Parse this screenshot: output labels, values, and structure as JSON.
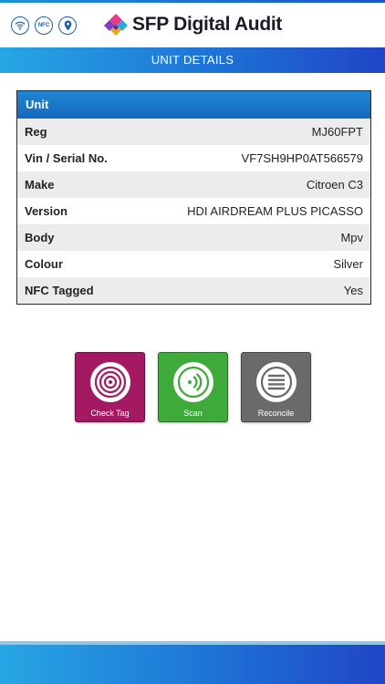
{
  "header": {
    "app_title": "SFP Digital Audit",
    "status_icons": [
      {
        "name": "wifi-icon"
      },
      {
        "name": "nfc-icon",
        "text": "NFC"
      },
      {
        "name": "location-pin-icon"
      }
    ]
  },
  "page_title": "UNIT DETAILS",
  "unit_card": {
    "title": "Unit",
    "rows": [
      {
        "label": "Reg",
        "value": "MJ60FPT"
      },
      {
        "label": "Vin / Serial No.",
        "value": "VF7SH9HP0AT566579"
      },
      {
        "label": "Make",
        "value": "Citroen C3"
      },
      {
        "label": "Version",
        "value": "HDI AIRDREAM PLUS PICASSO"
      },
      {
        "label": "Body",
        "value": "Mpv"
      },
      {
        "label": "Colour",
        "value": "Silver"
      },
      {
        "label": "NFC Tagged",
        "value": "Yes"
      }
    ]
  },
  "actions": {
    "check_tag": {
      "label": "Check Tag",
      "icon": "target-icon",
      "color": "#a31a62"
    },
    "scan": {
      "label": "Scan",
      "icon": "nfc-scan-icon",
      "color": "#3eaa3a"
    },
    "reconcile": {
      "label": "Reconcile",
      "icon": "list-lines-icon",
      "color": "#6a6a6a"
    }
  },
  "colors": {
    "primary_blue": "#1e73d6",
    "header_text": "#1b1b2a"
  }
}
